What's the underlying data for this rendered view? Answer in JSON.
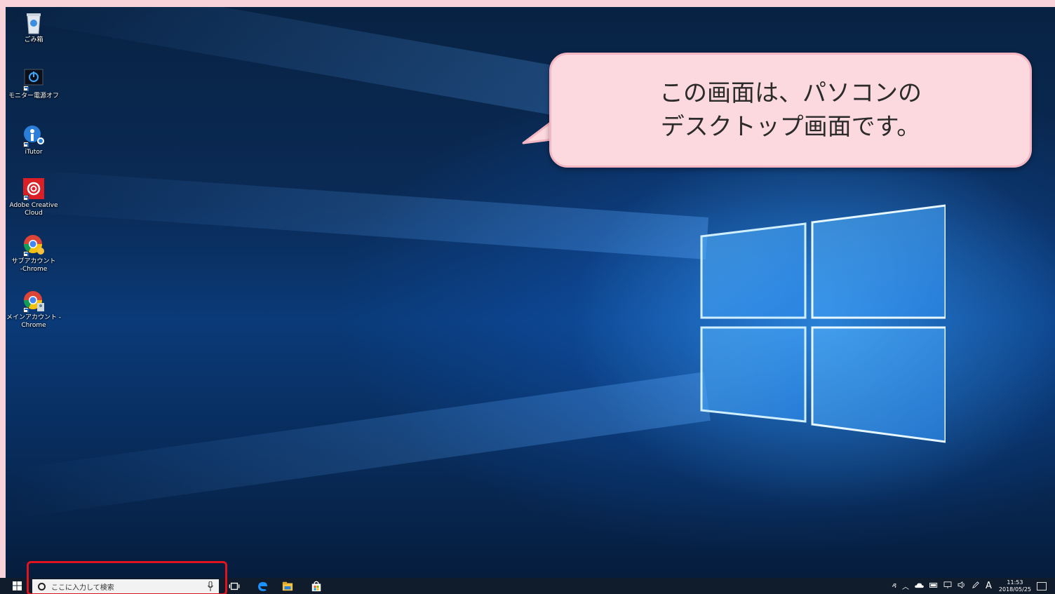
{
  "desktop_icons": [
    {
      "label": "ごみ箱",
      "icon": "recycle-bin-icon"
    },
    {
      "label": "モニター電源オフ",
      "icon": "power-icon"
    },
    {
      "label": "iTutor",
      "icon": "itutor-icon"
    },
    {
      "label": "Adobe Creative\nCloud",
      "icon": "adobe-creative-cloud-icon"
    },
    {
      "label": "サブアカウント\n-Chrome",
      "icon": "chrome-icon"
    },
    {
      "label": "メインアカウント -\nChrome",
      "icon": "chrome-icon"
    }
  ],
  "balloon": {
    "text": "この画面は、パソコンの\nデスクトップ画面です。"
  },
  "taskbar": {
    "search_placeholder": "ここに入力して検索",
    "pinned": [
      "task-view-icon",
      "edge-icon",
      "file-explorer-icon",
      "store-icon"
    ]
  },
  "tray": {
    "people": "ዳ",
    "chevron": "︿",
    "ime": "A",
    "time": "11:53",
    "date": "2018/05/25"
  },
  "colors": {
    "frame": "#f8d3da",
    "balloon_fill": "#fcd9de",
    "balloon_border": "#f4b6c2",
    "highlight": "#e0141e",
    "taskbar": "#101c2c"
  }
}
